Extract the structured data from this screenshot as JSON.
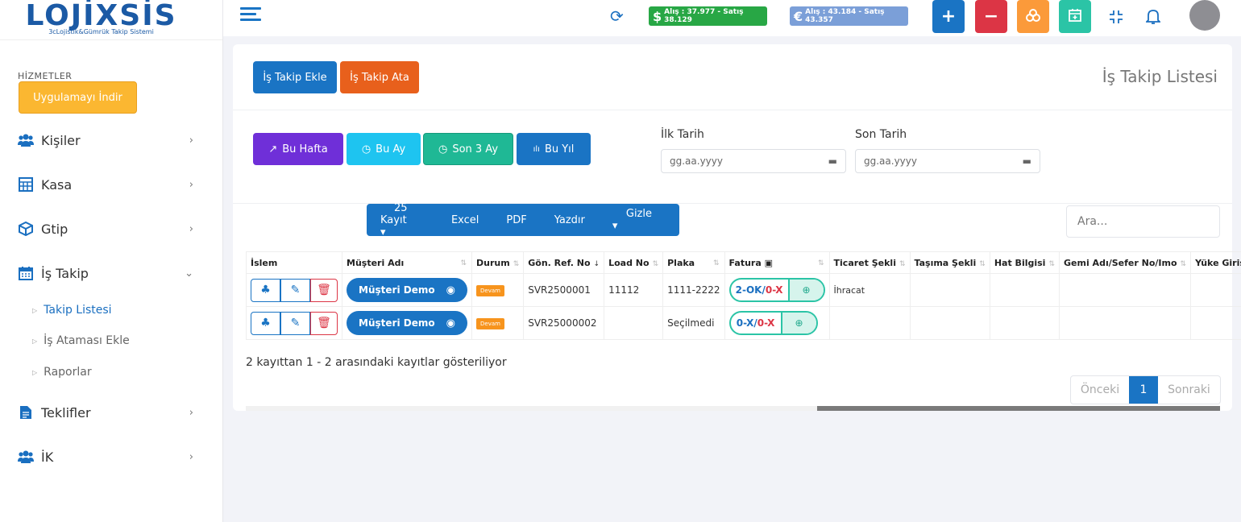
{
  "app": {
    "logo_text": "LOJİXSİS",
    "logo_sub": "3cLojistik&Gümrük Takip Sistemi"
  },
  "sidebar": {
    "section_title": "HİZMETLER",
    "app_button": "Uygulamayı İndir",
    "items": [
      {
        "label": "Kişiler",
        "icon": "users-icon"
      },
      {
        "label": "Kasa",
        "icon": "calculator-icon"
      },
      {
        "label": "Gtip",
        "icon": "cube-icon"
      },
      {
        "label": "İş Takip",
        "icon": "calendar-icon"
      },
      {
        "label": "Teklifler",
        "icon": "file-icon"
      },
      {
        "label": "İK",
        "icon": "users-icon"
      }
    ],
    "sub_items": [
      {
        "label": "Takip Listesi",
        "active": true
      },
      {
        "label": "İş Ataması Ekle",
        "active": false
      },
      {
        "label": "Raporlar",
        "active": false
      }
    ]
  },
  "topbar": {
    "usd_symbol": "$",
    "usd_rate": "Alış : 37.977 - Satış 38.129",
    "eur_symbol": "€",
    "eur_rate": "Alış : 43.184 - Satış 43.357",
    "colors": {
      "usd": "#28a745",
      "eur": "#7b9fd8",
      "plus": "#1a74c4",
      "minus": "#dc3545",
      "coins": "#fb9a3a",
      "calendar": "#2bc4a6"
    }
  },
  "card": {
    "add_button": "İş Takip Ekle",
    "assign_button": "İş Takip Ata",
    "title": "İş Takip Listesi",
    "filters": {
      "week": "Bu Hafta",
      "month": "Bu Ay",
      "three_months": "Son 3 Ay",
      "year": "Bu Yıl"
    },
    "start_date_label": "İlk Tarih",
    "end_date_label": "Son Tarih",
    "date_placeholder": "gg.aa.yyyy",
    "toolbar": {
      "records": "25 Kayıt",
      "excel": "Excel",
      "pdf": "PDF",
      "print": "Yazdır",
      "hide": "Gizle"
    },
    "search_placeholder": "Ara..."
  },
  "table": {
    "columns": [
      "İslem",
      "Müşteri Adı",
      "Durum",
      "Gön. Ref. No",
      "Load No",
      "Plaka",
      "Fatura",
      "Ticaret Şekli",
      "Taşıma Şekli",
      "Hat Bilgisi",
      "Gemi Adı/Sefer No/Imo",
      "Yüke Giriş"
    ],
    "rows": [
      {
        "customer": "Müşteri Demo",
        "status": "Devam",
        "ref": "SVR2500001",
        "load": "11112",
        "plate": "1111-2222",
        "fatura_ok": "2-OK",
        "fatura_sep": "/",
        "fatura_x": "0-X",
        "trade": "İhracat"
      },
      {
        "customer": "Müşteri Demo",
        "status": "Devam",
        "ref": "SVR25000002",
        "load": "",
        "plate": "Seçilmedi",
        "fatura_ok": "0-X",
        "fatura_sep": "/",
        "fatura_x": "0-X",
        "trade": ""
      }
    ]
  },
  "footer": {
    "info": "2 kayıttan 1 - 2 arasındaki kayıtlar gösteriliyor",
    "prev": "Önceki",
    "page": "1",
    "next": "Sonraki"
  }
}
